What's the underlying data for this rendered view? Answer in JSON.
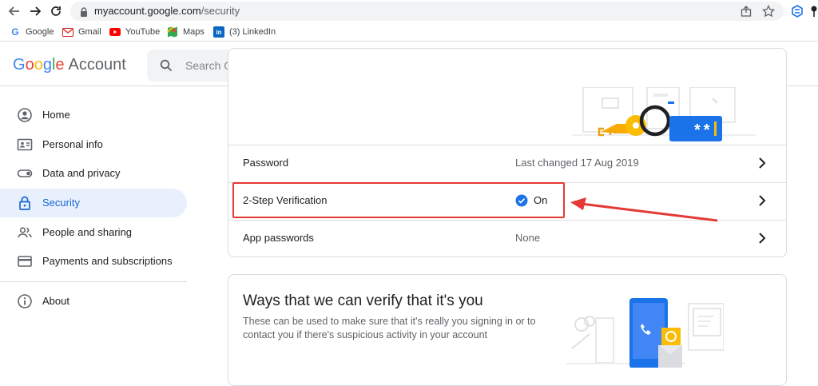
{
  "browser": {
    "url_host": "myaccount.google.com",
    "url_path": "/security"
  },
  "bookmarks": [
    {
      "label": "Google",
      "icon": "google-icon"
    },
    {
      "label": "Gmail",
      "icon": "gmail-icon"
    },
    {
      "label": "YouTube",
      "icon": "youtube-icon"
    },
    {
      "label": "Maps",
      "icon": "maps-icon"
    },
    {
      "label": "(3) LinkedIn",
      "icon": "linkedin-icon"
    }
  ],
  "header": {
    "logo_word": "Google",
    "logo_suffix": "Account",
    "search_placeholder": "Search Google Account"
  },
  "sidebar": {
    "items": [
      {
        "label": "Home",
        "icon": "home-icon"
      },
      {
        "label": "Personal info",
        "icon": "id-card-icon"
      },
      {
        "label": "Data and privacy",
        "icon": "toggle-icon"
      },
      {
        "label": "Security",
        "icon": "lock-icon",
        "active": true
      },
      {
        "label": "People and sharing",
        "icon": "people-icon"
      },
      {
        "label": "Payments and subscriptions",
        "icon": "card-icon"
      },
      {
        "label": "About",
        "icon": "info-icon"
      }
    ]
  },
  "signin": {
    "rows": [
      {
        "label": "Password",
        "value": "Last changed 17 Aug 2019"
      },
      {
        "label": "2-Step Verification",
        "value": "On"
      },
      {
        "label": "App passwords",
        "value": "None"
      }
    ],
    "password_mask": "**"
  },
  "verify": {
    "title": "Ways that we can verify that it's you",
    "description": "These can be used to make sure that it's really you signing in or to contact you if there's suspicious activity in your account"
  },
  "colors": {
    "accent": "#1a73e8",
    "active_bg": "#e8f0fe",
    "annotation": "#e53935"
  }
}
